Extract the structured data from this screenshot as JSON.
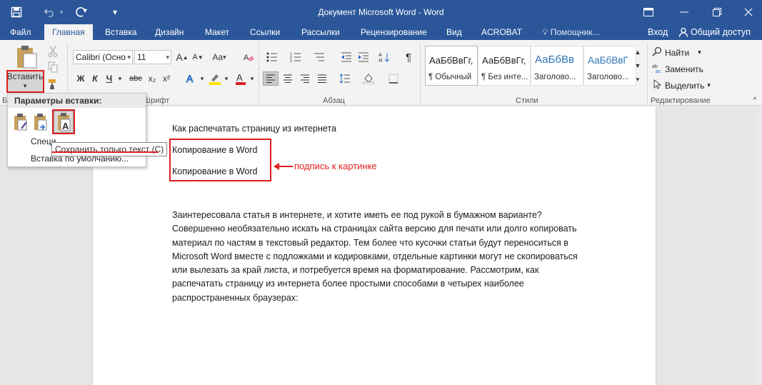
{
  "window": {
    "title": "Документ Microsoft Word - Word"
  },
  "tabs": [
    {
      "label": "Файл"
    },
    {
      "label": "Главная"
    },
    {
      "label": "Вставка"
    },
    {
      "label": "Дизайн"
    },
    {
      "label": "Макет"
    },
    {
      "label": "Ссылки"
    },
    {
      "label": "Рассылки"
    },
    {
      "label": "Рецензирование"
    },
    {
      "label": "Вид"
    },
    {
      "label": "ACROBAT"
    },
    {
      "label": "Помощник..."
    }
  ],
  "account": {
    "signin_label": "Вход",
    "share_label": "Общий доступ"
  },
  "ribbon": {
    "paste_label": "Вставить",
    "paste_arrow": "▾",
    "font": {
      "name": "Calibri (Осно",
      "size": "11",
      "bold": "Ж",
      "italic": "К",
      "underline": "Ч",
      "strike": "abc",
      "subscript": "x₂",
      "superscript": "x²",
      "grow": "A",
      "shrink": "A",
      "case": "Aa",
      "group_label": "Шрифт"
    },
    "paragraph": {
      "group_label": "Абзац",
      "pilcrow": "¶"
    },
    "styles": {
      "group_label": "Стили",
      "items": [
        {
          "sample": "АаБбВвГг,",
          "name": "¶ Обычный"
        },
        {
          "sample": "АаБбВвГг,",
          "name": "¶ Без инте..."
        },
        {
          "sample": "АаБбВв",
          "name": "Заголово..."
        },
        {
          "sample": "АаБбВвГ",
          "name": "Заголово..."
        }
      ]
    },
    "editing": {
      "group_label": "Редактирование",
      "find": "Найти",
      "replace": "Заменить",
      "select": "Выделить"
    },
    "clipboard_label_fragment": "Бу"
  },
  "paste_menu": {
    "header": "Параметры вставки:",
    "special": "Специ",
    "default": "Вставка по умолчанию...",
    "tooltip": "Сохранить только текст (С)"
  },
  "document": {
    "heading": "Как распечатать страницу из интернета",
    "copy_line_1": "Копирование в Word",
    "copy_line_2": "Копирование в Word",
    "annotation": "подпись к картинке",
    "paragraph": [
      "Заинтересовала статья в интернете, и хотите иметь ее под рукой в бумажном варианте?",
      "Совершенно необязательно искать на страницах сайта версию для печати или долго копировать",
      "материал по частям в текстовый редактор. Тем более что кусочки статьи будут переноситься в",
      "Microsoft Word вместе с подложками и кодировками, отдельные картинки могут не скопироваться",
      "или вылезать за край листа, и потребуется время на форматирование. Рассмотрим, как",
      "распечатать страницу из интернета более простыми способами в четырех наиболее",
      "распространенных браузерах:"
    ]
  },
  "colors": {
    "word_blue": "#2b579a",
    "annotation_red": "#e01f1f",
    "highlight_yellow": "#ffe600",
    "font_red": "#e01f1f"
  }
}
